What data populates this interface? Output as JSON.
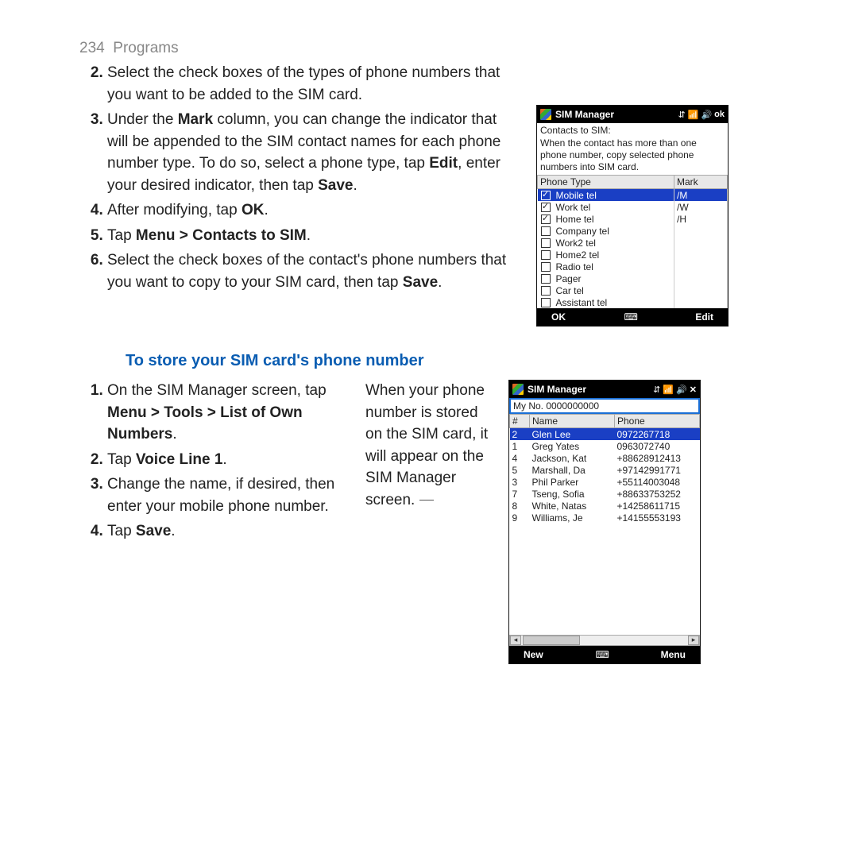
{
  "header": {
    "page": "234",
    "title": "Programs"
  },
  "steps_top": {
    "s2": "Select the check boxes of the types of phone numbers that you want to be added to the SIM card.",
    "s3_a": "Under the ",
    "s3_b": "Mark",
    "s3_c": " column, you can change the indicator that will be appended to the SIM contact names for each phone number type. To do so, select a phone type, tap ",
    "s3_d": "Edit",
    "s3_e": ", enter your desired indicator, then tap ",
    "s3_f": "Save",
    "s3_g": ".",
    "s4_a": "After modifying, tap ",
    "s4_b": "OK",
    "s4_c": ".",
    "s5_a": "Tap ",
    "s5_b": "Menu > Contacts to SIM",
    "s5_c": ".",
    "s6_a": "Select the check boxes of the contact's phone numbers that you want to copy to your SIM card, then tap ",
    "s6_b": "Save",
    "s6_c": "."
  },
  "section_title": "To store your SIM card's phone number",
  "steps_b": {
    "s1_a": "On the SIM Manager screen, tap ",
    "s1_b": "Menu > Tools > List of Own Numbers",
    "s1_c": ".",
    "s2_a": "Tap ",
    "s2_b": "Voice Line 1",
    "s2_c": ".",
    "s3": "Change the name, if desired, then enter your mobile phone number.",
    "s4_a": "Tap ",
    "s4_b": "Save",
    "s4_c": "."
  },
  "callout": "When your phone number is stored on the SIM card, it will appear on the SIM Manager screen.",
  "phone1": {
    "title": "SIM Manager",
    "ok": "ok",
    "sub": "Contacts to SIM:",
    "desc": "When the contact has more than one phone number, copy selected phone numbers into SIM card.",
    "col1": "Phone Type",
    "col2": "Mark",
    "rows": [
      {
        "chk": true,
        "sel": true,
        "name": "Mobile tel",
        "mark": "/M"
      },
      {
        "chk": true,
        "name": "Work tel",
        "mark": "/W"
      },
      {
        "chk": true,
        "name": "Home tel",
        "mark": "/H"
      },
      {
        "chk": false,
        "name": "Company tel",
        "mark": ""
      },
      {
        "chk": false,
        "name": "Work2 tel",
        "mark": ""
      },
      {
        "chk": false,
        "name": "Home2 tel",
        "mark": ""
      },
      {
        "chk": false,
        "name": "Radio tel",
        "mark": ""
      },
      {
        "chk": false,
        "name": "Pager",
        "mark": ""
      },
      {
        "chk": false,
        "name": "Car tel",
        "mark": ""
      },
      {
        "chk": false,
        "name": "Assistant tel",
        "mark": ""
      }
    ],
    "btn_l": "OK",
    "btn_r": "Edit"
  },
  "phone2": {
    "title": "SIM Manager",
    "close": "✕",
    "myno": "My No. 0000000000",
    "c1": "#",
    "c2": "Name",
    "c3": "Phone",
    "rows": [
      {
        "n": "2",
        "name": "Glen Lee",
        "ph": "0972267718",
        "sel": true
      },
      {
        "n": "1",
        "name": "Greg Yates",
        "ph": "0963072740"
      },
      {
        "n": "4",
        "name": "Jackson, Kat",
        "ph": "+88628912413"
      },
      {
        "n": "5",
        "name": "Marshall, Da",
        "ph": "+97142991771"
      },
      {
        "n": "3",
        "name": "Phil Parker",
        "ph": "+55114003048"
      },
      {
        "n": "7",
        "name": "Tseng, Sofia",
        "ph": "+88633753252"
      },
      {
        "n": "8",
        "name": "White, Natas",
        "ph": "+14258611715"
      },
      {
        "n": "9",
        "name": "Williams, Je",
        "ph": "+14155553193"
      }
    ],
    "btn_l": "New",
    "btn_r": "Menu"
  }
}
